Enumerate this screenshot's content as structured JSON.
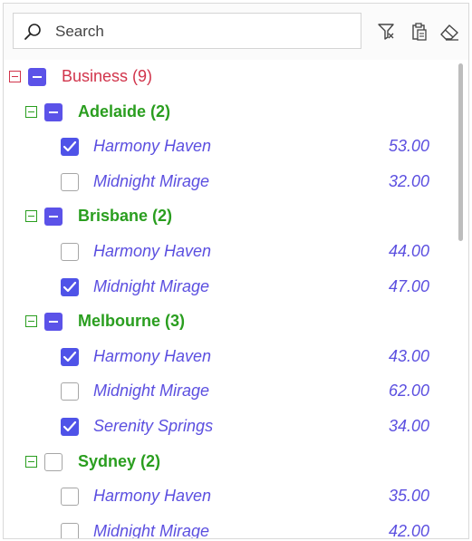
{
  "search": {
    "placeholder": "Search",
    "value": ""
  },
  "toolbar": {
    "icons": [
      "filter-icon",
      "clipboard-icon",
      "eraser-icon"
    ]
  },
  "colors": {
    "root": "#d1344b",
    "group": "#2a9e1f",
    "item": "#5b4fe0",
    "checkbox": "#4f53e8"
  },
  "tree": {
    "root": {
      "label": "Business (9)",
      "state": "partial",
      "expanded": true
    },
    "groups": [
      {
        "label": "Adelaide (2)",
        "state": "partial",
        "expanded": true,
        "items": [
          {
            "label": "Harmony Haven",
            "value": "53.00",
            "checked": true
          },
          {
            "label": "Midnight Mirage",
            "value": "32.00",
            "checked": false
          }
        ]
      },
      {
        "label": "Brisbane (2)",
        "state": "partial",
        "expanded": true,
        "items": [
          {
            "label": "Harmony Haven",
            "value": "44.00",
            "checked": false
          },
          {
            "label": "Midnight Mirage",
            "value": "47.00",
            "checked": true
          }
        ]
      },
      {
        "label": "Melbourne (3)",
        "state": "partial",
        "expanded": true,
        "items": [
          {
            "label": "Harmony Haven",
            "value": "43.00",
            "checked": true
          },
          {
            "label": "Midnight Mirage",
            "value": "62.00",
            "checked": false
          },
          {
            "label": "Serenity Springs",
            "value": "34.00",
            "checked": true
          }
        ]
      },
      {
        "label": "Sydney (2)",
        "state": "unchecked",
        "expanded": true,
        "items": [
          {
            "label": "Harmony Haven",
            "value": "35.00",
            "checked": false
          },
          {
            "label": "Midnight Mirage",
            "value": "42.00",
            "checked": false
          }
        ]
      }
    ]
  }
}
